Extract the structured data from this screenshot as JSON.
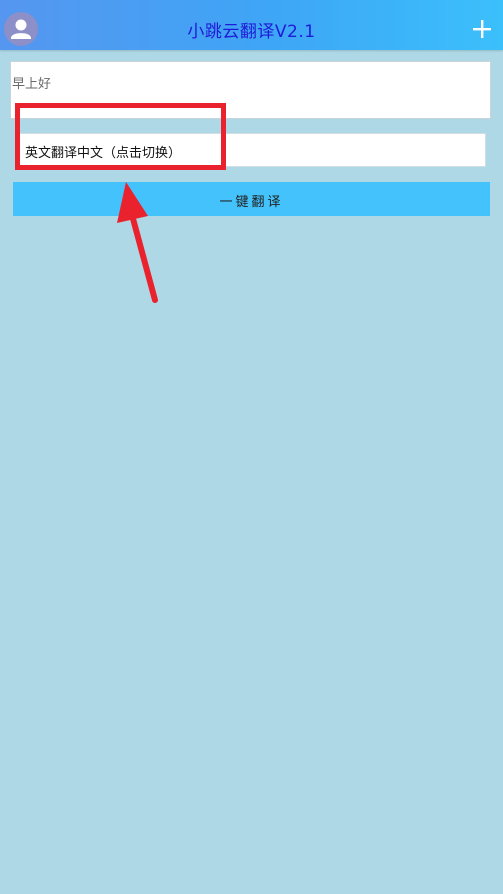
{
  "header": {
    "title": "小跳云翻译V2.1",
    "gradient_colors": [
      "#5596f0",
      "#3ea6f6",
      "#3bc0fb"
    ],
    "title_color": "#1f1ad8",
    "left_icon": "user-icon",
    "right_icon": "plus-icon"
  },
  "input": {
    "value": "早上好",
    "placeholder": ""
  },
  "language_switch": {
    "label": "英文翻译中文（点击切换）"
  },
  "translate_button": {
    "label": "一键翻译",
    "color": "#43c2fc"
  },
  "annotations": {
    "highlight_color": "#e9222e",
    "arrow_color": "#e9222e"
  },
  "page": {
    "background": "#aed8e6"
  }
}
